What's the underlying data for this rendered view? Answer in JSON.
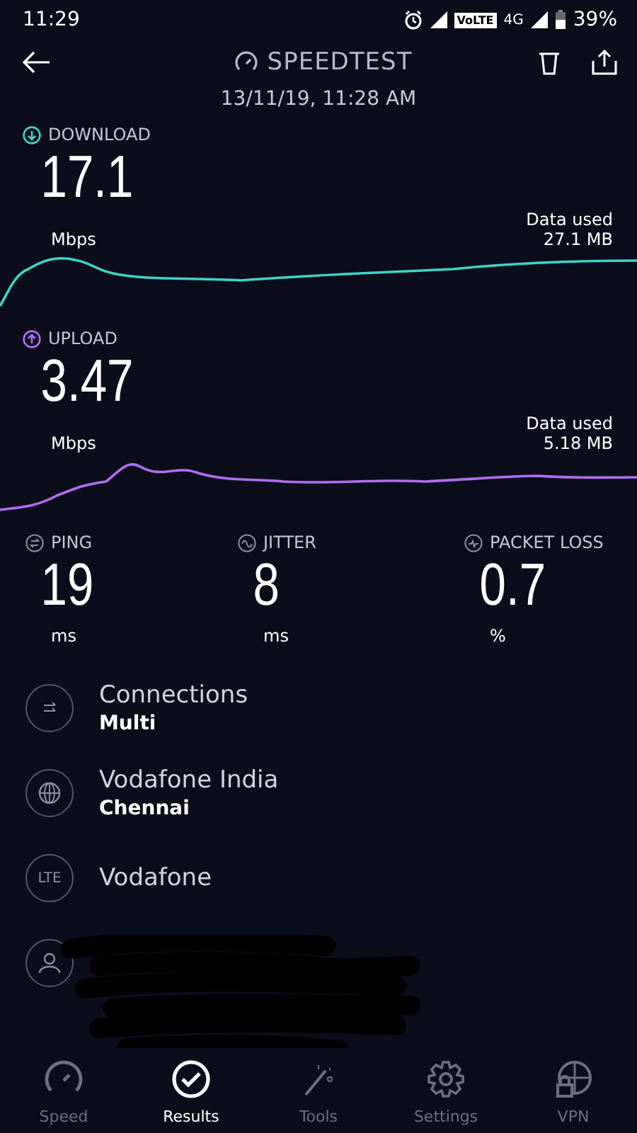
{
  "status_bar": {
    "time": "11:29",
    "volte": "VoLTE",
    "network": "4G",
    "battery": "39%"
  },
  "header": {
    "title": "SPEEDTEST",
    "date": "13/11/19, 11:28 AM"
  },
  "speeds": [
    {
      "kind": "download",
      "label": "DOWNLOAD",
      "value": "17.1",
      "unit": "Mbps",
      "data_label": "Data used",
      "data_value": "27.1 MB",
      "color": "#3fd3c4"
    },
    {
      "kind": "upload",
      "label": "UPLOAD",
      "value": "3.47",
      "unit": "Mbps",
      "data_label": "Data used",
      "data_value": "5.18 MB",
      "color": "#b06ef0"
    }
  ],
  "metrics": [
    {
      "kind": "ping",
      "label": "PING",
      "value": "19",
      "unit": "ms"
    },
    {
      "kind": "jitter",
      "label": "JITTER",
      "value": "8",
      "unit": "ms"
    },
    {
      "kind": "loss",
      "label": "PACKET LOSS",
      "value": "0.7",
      "unit": "%"
    }
  ],
  "details": [
    {
      "kind": "connections",
      "title": "Connections",
      "subtitle": "Multi"
    },
    {
      "kind": "server",
      "title": "Vodafone India",
      "subtitle": "Chennai"
    },
    {
      "kind": "lte",
      "icon_text": "LTE",
      "title": "Vodafone"
    },
    {
      "kind": "user",
      "redacted": true
    }
  ],
  "nav": [
    {
      "kind": "speed",
      "label": "Speed",
      "selected": false
    },
    {
      "kind": "results",
      "label": "Results",
      "selected": true
    },
    {
      "kind": "tools",
      "label": "Tools",
      "selected": false
    },
    {
      "kind": "settings",
      "label": "Settings",
      "selected": false
    },
    {
      "kind": "vpn",
      "label": "VPN",
      "selected": false
    }
  ]
}
